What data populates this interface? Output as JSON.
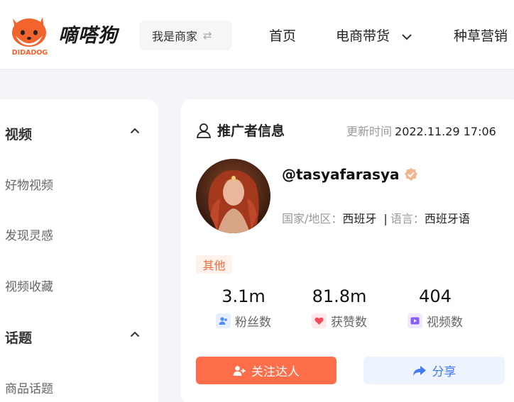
{
  "header": {
    "logo_text": "DIDADOG",
    "brand": "嘀嗒狗",
    "merchant_switch": "我是商家",
    "nav": [
      {
        "label": "首页"
      },
      {
        "label": "电商带货"
      },
      {
        "label": "种草营销"
      }
    ]
  },
  "sidebar": {
    "groups": [
      {
        "title": "视频",
        "items": [
          "好物视频",
          "发现灵感",
          "视频收藏"
        ]
      },
      {
        "title": "话题",
        "items": [
          "商品话题"
        ]
      }
    ]
  },
  "promoter": {
    "section_title": "推广者信息",
    "update_label": "更新时间",
    "update_value": "2022.11.29 17:06",
    "handle": "@tasyafarasya",
    "country_label": "国家/地区：",
    "country": "西班牙",
    "separator": "|",
    "language_label": "语言：",
    "language": "西班牙语",
    "tag": "其他",
    "stats": [
      {
        "value": "3.1m",
        "label": "粉丝数",
        "icon": "fans-icon",
        "color": "#4f8bf7"
      },
      {
        "value": "81.8m",
        "label": "获赞数",
        "icon": "heart-icon",
        "color": "#f04b55"
      },
      {
        "value": "404",
        "label": "视频数",
        "icon": "video-icon",
        "color": "#8a5cf6"
      }
    ],
    "follow_button": "关注达人",
    "share_button": "分享"
  },
  "colors": {
    "accent": "#ff6e4a",
    "share_bg": "#eef4ff",
    "share_text": "#3f7cf4",
    "tag_bg": "#fff1ec",
    "tag_text": "#f26b3a"
  }
}
